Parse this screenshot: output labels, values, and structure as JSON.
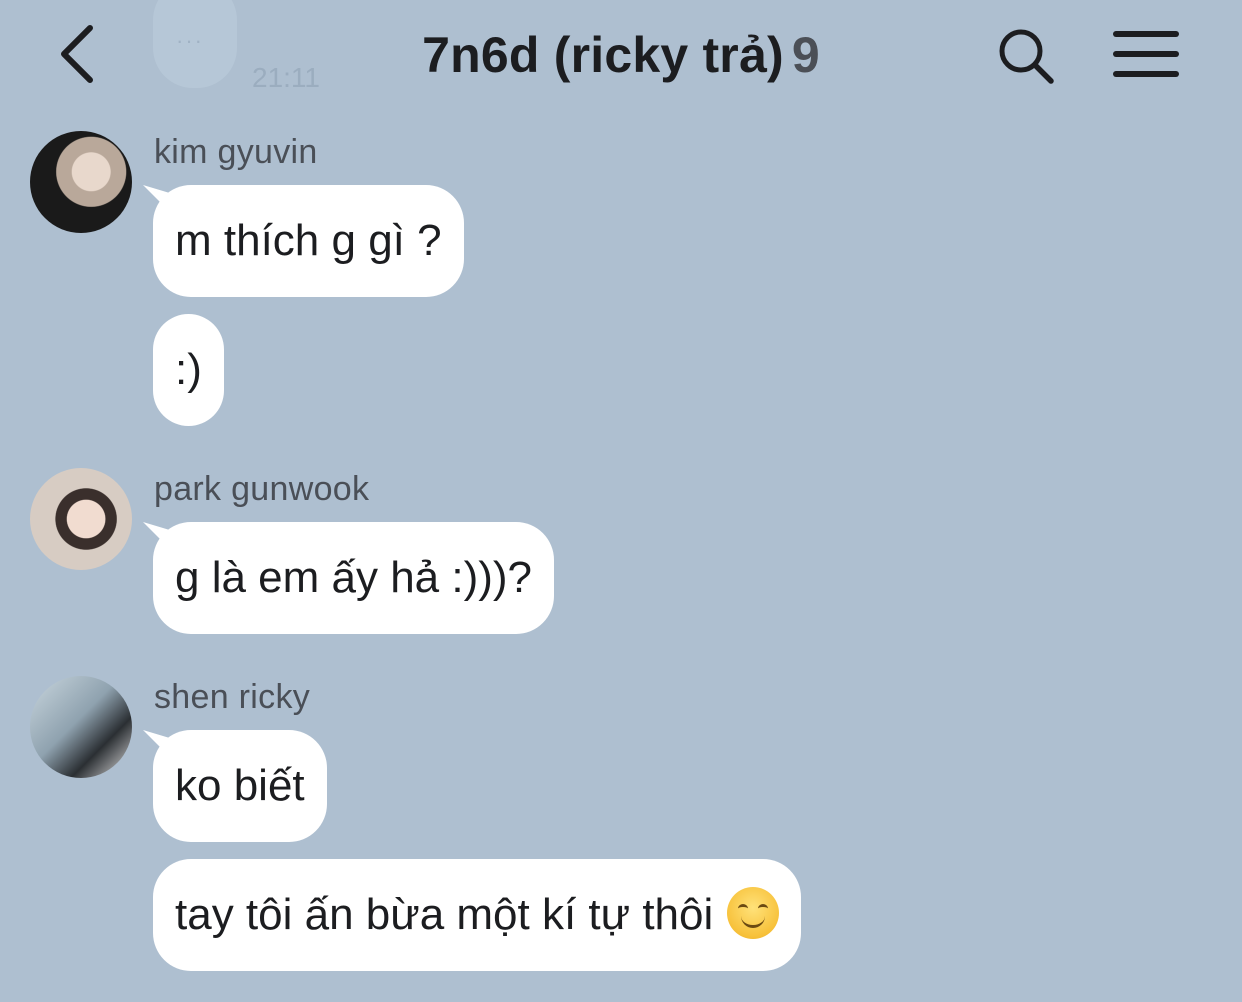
{
  "header": {
    "back_label": "back",
    "title": "7n6d (ricky trả)",
    "member_count": "9",
    "search_label": "search",
    "menu_label": "menu"
  },
  "ghost": {
    "dots": "···",
    "time": "21:11"
  },
  "messages": [
    {
      "sender": "kim gyuvin",
      "bubbles": [
        "m thích g gì ?",
        ":)"
      ]
    },
    {
      "sender": "park gunwook",
      "bubbles": [
        "g là em ấy hả :)))?"
      ]
    },
    {
      "sender": "shen ricky",
      "bubbles": [
        "ko biết",
        "tay tôi ấn bừa một kí tự thôi"
      ]
    }
  ],
  "icons": {
    "back": "chevron-left-icon",
    "search": "search-icon",
    "menu": "hamburger-menu-icon",
    "emoji": "smiling-face-emoji"
  },
  "colors": {
    "background": "#aebfd0",
    "bubble": "#ffffff",
    "text": "#1c1d20",
    "sender_text": "#4a4f57"
  }
}
